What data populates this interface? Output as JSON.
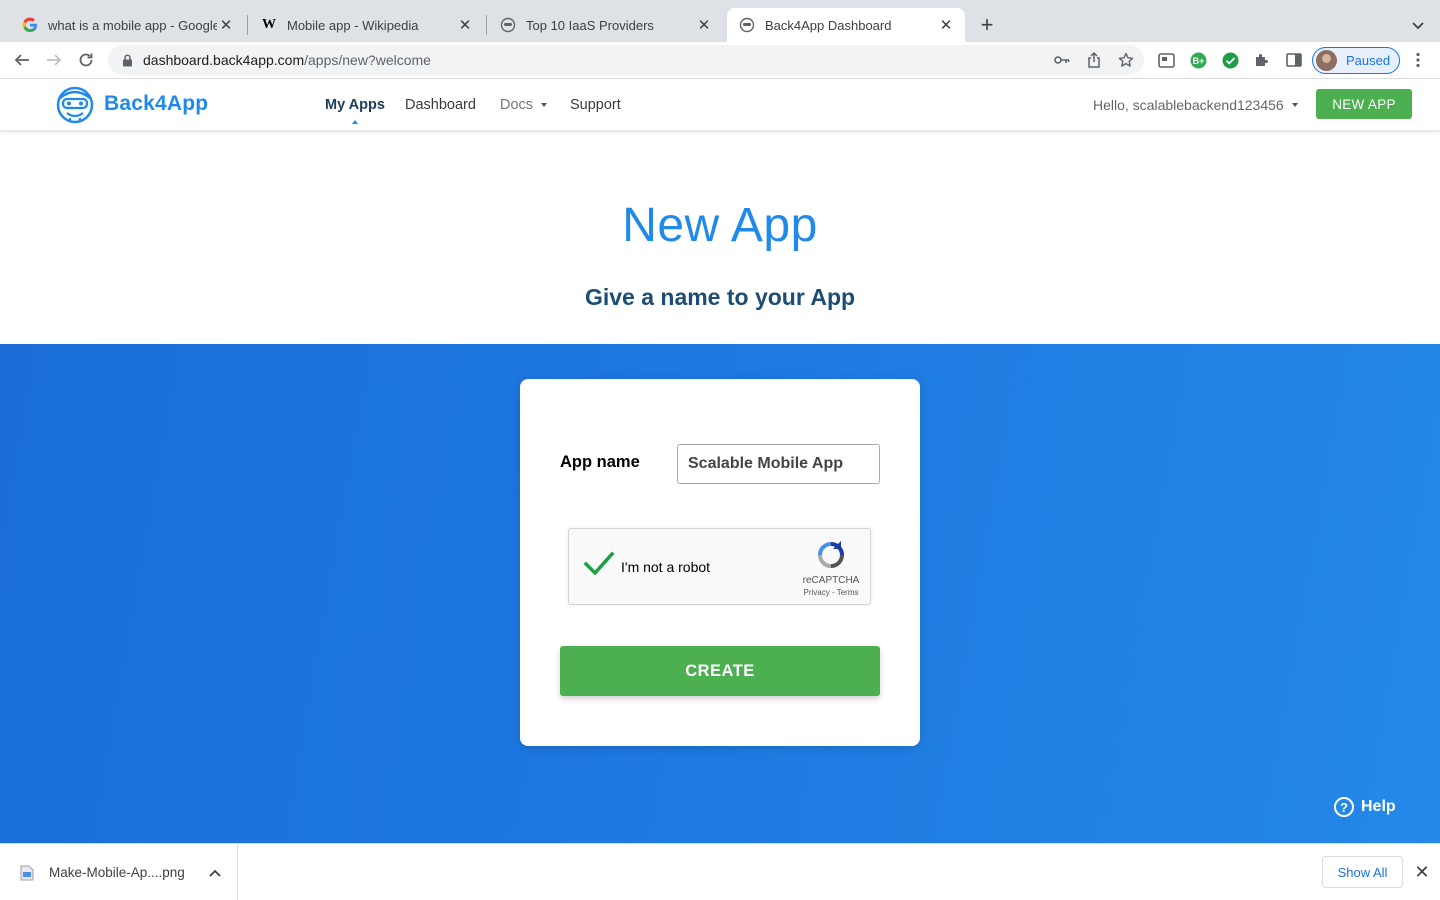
{
  "browser": {
    "tabs": [
      {
        "title": "what is a mobile app - Google S",
        "favicon": "google-g-icon"
      },
      {
        "title": "Mobile app - Wikipedia",
        "favicon": "wikipedia-w-icon"
      },
      {
        "title": "Top 10 IaaS Providers",
        "favicon": "back4app-icon"
      },
      {
        "title": "Back4App Dashboard",
        "favicon": "back4app-icon"
      }
    ],
    "active_tab": 3,
    "url_host": "dashboard.back4app.com",
    "url_path": "/apps/new?welcome",
    "profile_label": "Paused"
  },
  "header": {
    "logo_text": "Back4App",
    "nav": [
      "My Apps",
      "Dashboard",
      "Docs",
      "Support"
    ],
    "active_nav": "My Apps",
    "greeting": "Hello, scalablebackend123456",
    "new_app_label": "NEW APP"
  },
  "hero": {
    "title": "New App",
    "subtitle": "Give a name to your App"
  },
  "form": {
    "app_name_label": "App name",
    "app_name_value": "Scalable Mobile App",
    "captcha_label": "I'm not a robot",
    "captcha_brand": "reCAPTCHA",
    "captcha_links": "Privacy - Terms",
    "captcha_checked": true,
    "create_label": "CREATE"
  },
  "help_label": "Help",
  "downloads": {
    "file_name": "Make-Mobile-Ap....png",
    "show_all_label": "Show All"
  },
  "colors": {
    "brand_blue": "#208aec",
    "heading_navy": "#1c4e74",
    "button_green": "#4caf50",
    "background_blue": "#1e79e1"
  }
}
